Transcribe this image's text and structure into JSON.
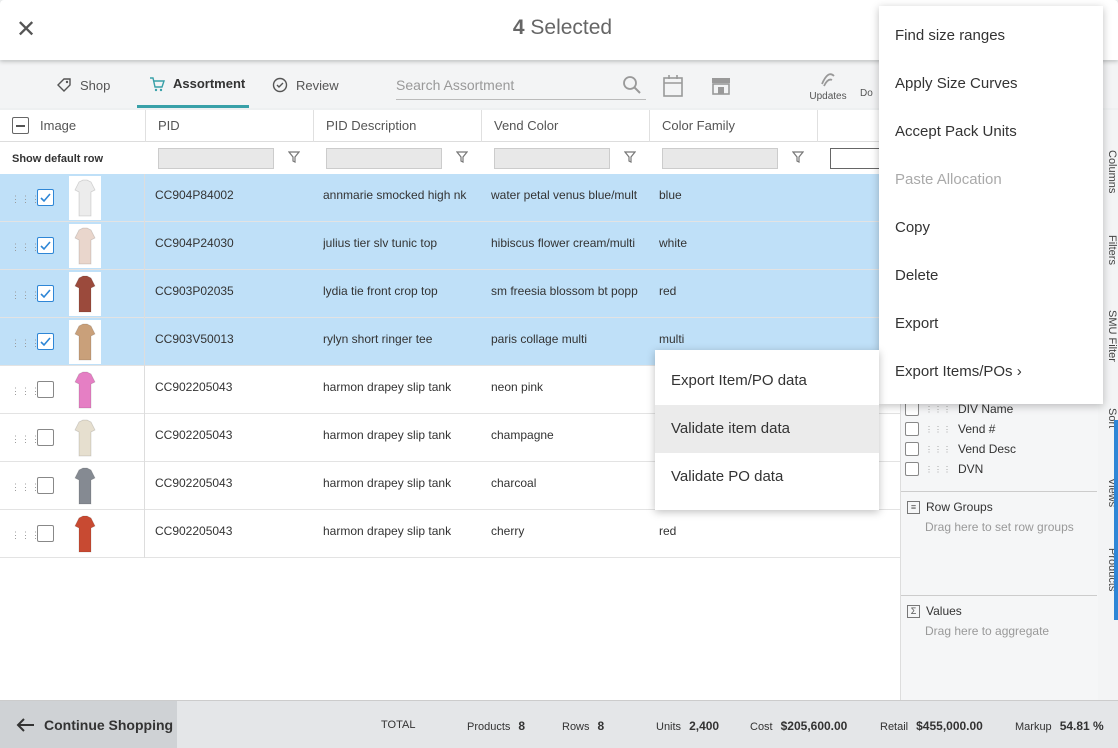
{
  "header": {
    "count": "4",
    "title": "Selected"
  },
  "toolbar": {
    "tabs": [
      {
        "label": "Shop",
        "icon": "tag-icon"
      },
      {
        "label": "Assortment",
        "icon": "cart-icon"
      },
      {
        "label": "Review",
        "icon": "check-circle-icon"
      }
    ],
    "search_placeholder": "Search Assortment",
    "updates_label": "Updates",
    "do_label": "Do"
  },
  "grid": {
    "columns": [
      "Image",
      "PID",
      "PID Description",
      "Vend Color",
      "Color Family"
    ],
    "show_default_row": "Show default row",
    "rows": [
      {
        "selected": true,
        "pid": "CC904P84002",
        "desc": "annmarie smocked high nk",
        "vend_color": "water petal venus blue/mult",
        "color_family": "blue",
        "thumb_color": "#ececec"
      },
      {
        "selected": true,
        "pid": "CC904P24030",
        "desc": "julius tier slv tunic top",
        "vend_color": "hibiscus flower cream/multi",
        "color_family": "white",
        "thumb_color": "#e9d6cc"
      },
      {
        "selected": true,
        "pid": "CC903P02035",
        "desc": "lydia tie front crop top",
        "vend_color": "sm freesia blossom bt popp",
        "color_family": "red",
        "thumb_color": "#9b4a3c"
      },
      {
        "selected": true,
        "pid": "CC903V50013",
        "desc": "rylyn short ringer tee",
        "vend_color": "paris collage multi",
        "color_family": "multi",
        "thumb_color": "#c9a07a"
      },
      {
        "selected": false,
        "pid": "CC902205043",
        "desc": "harmon drapey slip tank",
        "vend_color": "neon pink",
        "color_family": "",
        "thumb_color": "#e57fc4"
      },
      {
        "selected": false,
        "pid": "CC902205043",
        "desc": "harmon drapey slip tank",
        "vend_color": "champagne",
        "color_family": "",
        "thumb_color": "#e6dfcf"
      },
      {
        "selected": false,
        "pid": "CC902205043",
        "desc": "harmon drapey slip tank",
        "vend_color": "charcoal",
        "color_family": "",
        "thumb_color": "#858a92"
      },
      {
        "selected": false,
        "pid": "CC902205043",
        "desc": "harmon drapey slip tank",
        "vend_color": "cherry",
        "color_family": "red",
        "thumb_color": "#c84a32"
      }
    ]
  },
  "side_panel": {
    "columns": [
      "DIV Name",
      "Vend #",
      "Vend Desc",
      "DVN"
    ],
    "row_groups_title": "Row Groups",
    "row_groups_hint": "Drag here to set row groups",
    "values_title": "Values",
    "values_hint": "Drag here to aggregate",
    "vertical_tabs": [
      "Columns",
      "Filters",
      "SMU Filter",
      "Sort",
      "Views",
      "Products"
    ]
  },
  "context_menu": {
    "items": [
      "Find size ranges",
      "Apply Size Curves",
      "Accept Pack Units",
      "Paste Allocation",
      "Copy",
      "Delete",
      "Export",
      "Export Items/POs"
    ],
    "disabled": "Paste Allocation"
  },
  "submenu": {
    "items": [
      "Export Item/PO data",
      "Validate item data",
      "Validate PO data"
    ]
  },
  "footer": {
    "continue_label": "Continue Shopping",
    "total_label": "TOTAL",
    "products_label": "Products",
    "products_value": "8",
    "rows_label": "Rows",
    "rows_value": "8",
    "units_label": "Units",
    "units_value": "2,400",
    "cost_label": "Cost",
    "cost_value": "$205,600.00",
    "retail_label": "Retail",
    "retail_value": "$455,000.00",
    "markup_label": "Markup",
    "markup_value": "54.81 %"
  },
  "colors": {
    "selected_row": "#bfe0f8",
    "accent": "#38a0a8",
    "checkbox": "#2e86d6"
  }
}
